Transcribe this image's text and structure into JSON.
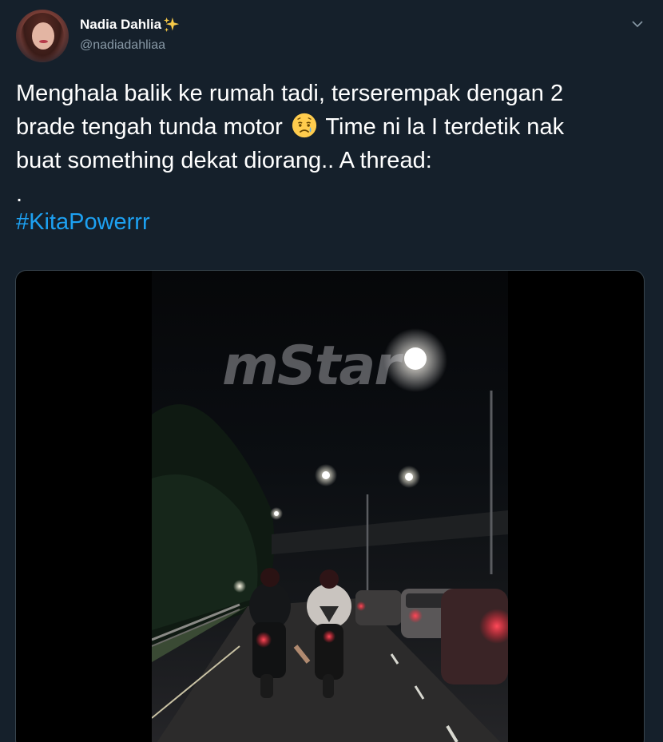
{
  "author": {
    "display_name": "Nadia Dahlia",
    "handle": "@nadiadahliaa",
    "badge_icon": "sparkles-icon"
  },
  "tweet": {
    "line1": "Menghala balik ke rumah tadi, terserempak dengan 2",
    "line2_before_emoji": "brade tengah tunda motor",
    "line2_after_emoji": "Time ni la I terdetik nak",
    "line3": "buat something dekat diorang.. A thread:",
    "line4": ".",
    "hashtag": "#KitaPowerrr",
    "emoji": "sad-but-relieved-face-icon"
  },
  "media": {
    "watermark": "mStar"
  },
  "colors": {
    "background": "#15202b",
    "text": "#ffffff",
    "secondary": "#8899a6",
    "link": "#1da1f2"
  }
}
